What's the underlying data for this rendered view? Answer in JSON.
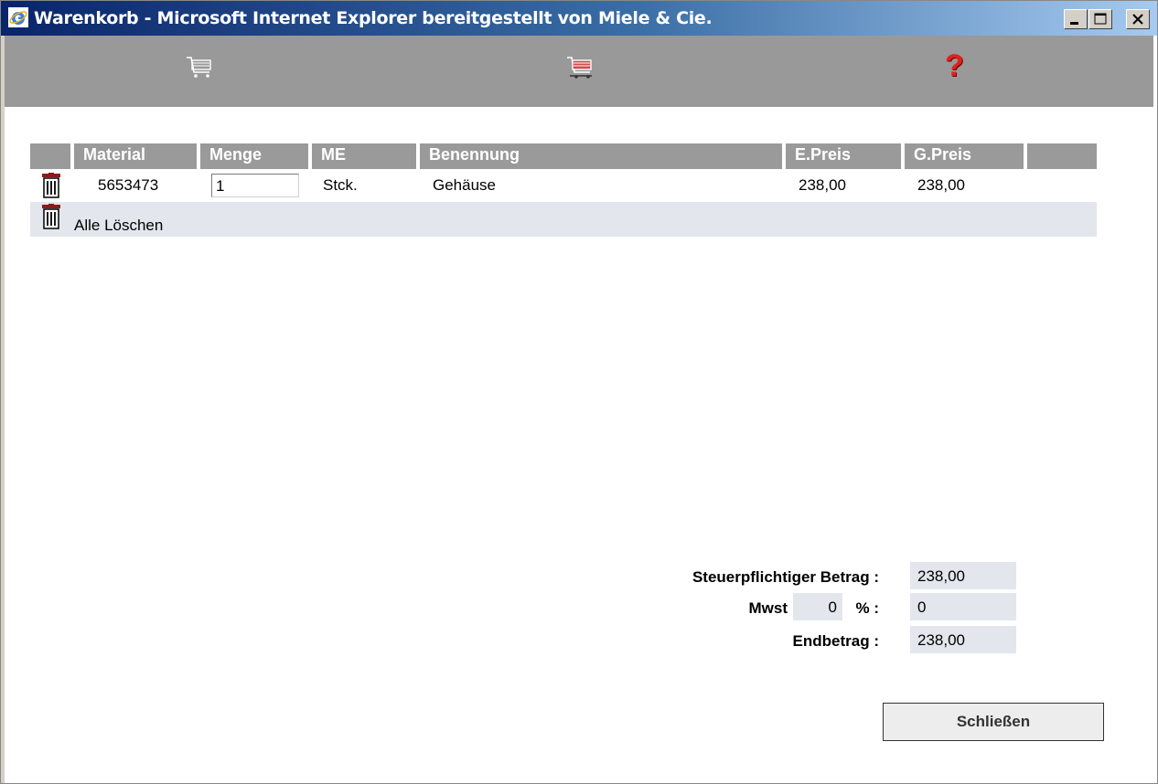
{
  "window": {
    "title": "Warenkorb - Microsoft Internet Explorer bereitgestellt von Miele & Cie.",
    "icon": "ie-icon",
    "controls": [
      "minimize-icon",
      "maximize-icon",
      "close-icon"
    ]
  },
  "toolbar": {
    "items": [
      {
        "name": "cart-icon"
      },
      {
        "name": "cart-red-icon"
      },
      {
        "name": "help-icon",
        "glyph": "?"
      }
    ]
  },
  "table": {
    "headers": {
      "material": "Material",
      "menge": "Menge",
      "me": "ME",
      "benennung": "Benennung",
      "epreis": "E.Preis",
      "gpreis": "G.Preis"
    },
    "rows": [
      {
        "material": "5653473",
        "menge": "1",
        "me": "Stck.",
        "benennung": "Gehäuse",
        "epreis": "238,00",
        "gpreis": "238,00"
      }
    ],
    "delete_all_label": "Alle Löschen"
  },
  "summary": {
    "taxable_label": "Steuerpflichtiger Betrag :",
    "taxable_value": "238,00",
    "vat_label": "Mwst",
    "vat_rate": "0",
    "vat_suffix": "% :",
    "vat_value": "0",
    "total_label": "Endbetrag :",
    "total_value": "238,00"
  },
  "close_button": "Schließen",
  "colors": {
    "titlebar_start": "#0a246a",
    "titlebar_end": "#a6caf0",
    "toolbar_bg": "#999999",
    "header_bg": "#9a9a9a",
    "row_bg": "#e3e6ec",
    "help": "#e02020",
    "trash": "#8b1a1a"
  }
}
